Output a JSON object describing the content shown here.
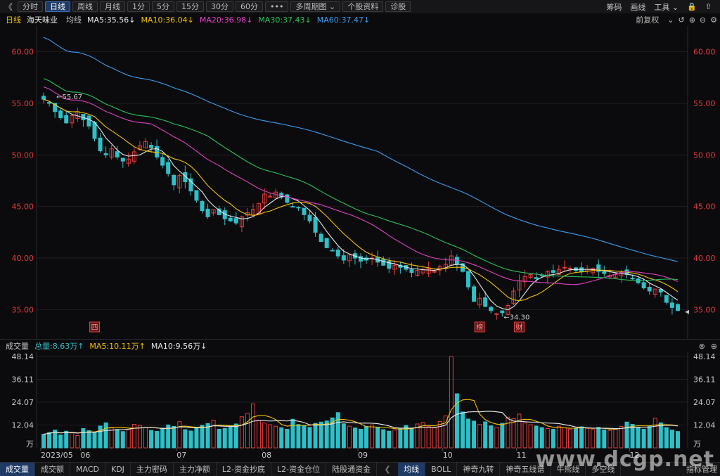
{
  "toolbar": {
    "back": "《",
    "tabs": [
      "分时",
      "日线",
      "周线",
      "月线",
      "1分",
      "5分",
      "15分",
      "30分",
      "60分",
      "•••",
      "多周期图 ⌄",
      "个股资料",
      "诊股"
    ],
    "active_index": 1,
    "right": [
      "筹码",
      "画线",
      "工具 ⌄",
      "🔒",
      "⇧"
    ]
  },
  "price_legend": {
    "period": "日线",
    "name": "海天味业",
    "ma_label": "均线",
    "items": [
      {
        "text": "MA5:35.56↓",
        "color": "#e8e8e8"
      },
      {
        "text": "MA10:36.04↓",
        "color": "#f2c200"
      },
      {
        "text": "MA20:36.98↓",
        "color": "#e040c0"
      },
      {
        "text": "MA30:37.43↓",
        "color": "#27c45a"
      },
      {
        "text": "MA60:37.47↓",
        "color": "#3a9cf0"
      }
    ],
    "right_label": "前复权",
    "right_icons": [
      "⌄",
      "↺",
      "⊕",
      "⊖",
      "⚙"
    ]
  },
  "volume_legend": {
    "name": "成交量",
    "items": [
      {
        "text": "总量:8.63万↑",
        "color": "#2ec0c8"
      },
      {
        "text": "MA5:10.11万↑",
        "color": "#f2c200"
      },
      {
        "text": "MA10:9.56万↓",
        "color": "#e8e8e8"
      }
    ],
    "right_icons": [
      "⊗",
      "⊕"
    ]
  },
  "chart_data": {
    "type": "candlestick",
    "price_axis": {
      "ticks": [
        "60.00",
        "55.00",
        "50.00",
        "45.00",
        "40.00",
        "35.00"
      ],
      "values": [
        60,
        55,
        50,
        45,
        40,
        35
      ],
      "range": [
        32.5,
        62.5
      ]
    },
    "volume_axis": {
      "ticks": [
        "48.14",
        "36.11",
        "24.07",
        "12.04",
        "万"
      ],
      "values": [
        48.14,
        36.11,
        24.07,
        12.04,
        0
      ],
      "range": [
        0,
        48.14
      ]
    },
    "x_labels": [
      {
        "text": "2023/05",
        "index": 0
      },
      {
        "text": "06",
        "index": 7
      },
      {
        "text": "07",
        "index": 24
      },
      {
        "text": "08",
        "index": 39
      },
      {
        "text": "09",
        "index": 56
      },
      {
        "text": "10",
        "index": 71
      },
      {
        "text": "11",
        "index": 84
      },
      {
        "text": "12",
        "index": 104
      }
    ],
    "annotations": [
      {
        "text": "55.67",
        "index": 2,
        "value": 55.67
      },
      {
        "text": "34.30",
        "index": 81,
        "value": 34.3
      }
    ],
    "markers": [
      {
        "text": "四",
        "index": 9
      },
      {
        "text": "榜",
        "index": 77
      },
      {
        "text": "财",
        "index": 84
      }
    ],
    "colors": {
      "up": "#e63b3b",
      "down": "#2ec0c8",
      "ma5": "#e8e8e8",
      "ma10": "#f2c200",
      "ma20": "#e040c0",
      "ma30": "#27c45a",
      "ma60": "#3a9cf0",
      "axis_text": "#e63b3b"
    },
    "close": [
      55.4,
      55.0,
      54.2,
      53.6,
      53.1,
      53.8,
      54.2,
      53.4,
      52.8,
      51.6,
      50.4,
      50.0,
      50.6,
      49.8,
      49.4,
      49.6,
      50.3,
      50.9,
      51.3,
      50.7,
      49.8,
      49.0,
      48.2,
      47.1,
      48.0,
      47.4,
      46.5,
      45.6,
      44.6,
      44.0,
      44.7,
      44.2,
      43.8,
      43.6,
      43.4,
      44.0,
      44.4,
      44.7,
      45.3,
      46.2,
      46.0,
      46.4,
      45.9,
      45.4,
      45.0,
      44.9,
      44.2,
      43.6,
      42.5,
      41.6,
      41.0,
      40.7,
      40.2,
      39.8,
      40.3,
      40.0,
      39.7,
      39.8,
      40.0,
      39.6,
      39.3,
      39.0,
      39.3,
      39.1,
      38.9,
      38.6,
      38.8,
      38.9,
      39.0,
      38.7,
      39.2,
      39.4,
      40.2,
      39.4,
      38.7,
      37.2,
      35.8,
      36.1,
      35.3,
      34.9,
      34.6,
      34.7,
      35.4,
      36.8,
      37.8,
      38.2,
      38.4,
      38.0,
      38.3,
      38.7,
      38.6,
      38.9,
      39.1,
      39.0,
      38.8,
      38.7,
      38.9,
      39.0,
      38.7,
      38.5,
      38.3,
      38.4,
      38.6,
      38.4,
      38.0,
      37.6,
      37.1,
      36.8,
      37.0,
      36.7,
      35.7,
      35.2,
      34.9
    ],
    "volume": [
      7.2,
      8.1,
      9.4,
      6.8,
      8.8,
      7.9,
      6.5,
      10.2,
      9.1,
      8.3,
      11.5,
      13.2,
      10.8,
      9.7,
      8.6,
      9.9,
      12.4,
      11.8,
      10.6,
      9.2,
      8.7,
      10.4,
      12.1,
      11.3,
      13.8,
      9.6,
      8.9,
      10.7,
      11.9,
      12.8,
      14.6,
      9.8,
      10.3,
      11.1,
      12.6,
      16.4,
      18.2,
      23.2,
      14.5,
      13.1,
      12.2,
      11.4,
      10.6,
      9.8,
      15.1,
      12.3,
      11.5,
      10.8,
      12.9,
      13.6,
      14.2,
      15.8,
      18.6,
      12.7,
      11.4,
      10.5,
      9.8,
      11.3,
      12.1,
      10.9,
      9.6,
      8.8,
      9.4,
      10.3,
      11.8,
      10.1,
      12.6,
      13.4,
      11.2,
      10.6,
      13.9,
      16.8,
      48.1,
      28.5,
      18.9,
      15.2,
      14.1,
      12.3,
      13.7,
      11.6,
      10.8,
      12.9,
      16.2,
      15.4,
      17.8,
      13.1,
      12.2,
      11.5,
      10.7,
      10.2,
      9.8,
      11.4,
      10.6,
      9.9,
      10.4,
      11.1,
      10.3,
      9.7,
      10.8,
      9.5,
      9.2,
      10.1,
      11.3,
      13.6,
      12.4,
      10.9,
      9.8,
      11.6,
      15.6,
      13.2,
      10.7,
      9.4,
      8.63
    ]
  },
  "bottom_tabs": [
    "成交量",
    "成交额",
    "MACD",
    "KDJ",
    "主力密码",
    "主力净额",
    "L2-资金抄底",
    "L2-资金仓位",
    "陆股通资金",
    "❮",
    "均线",
    "BOLL",
    "神奇九转",
    "神奇五线谱",
    "牛熊线",
    "多空线"
  ],
  "bottom_active": [
    0,
    10
  ],
  "bottom_right": "指标管理",
  "watermark": "www.dcgp.net"
}
